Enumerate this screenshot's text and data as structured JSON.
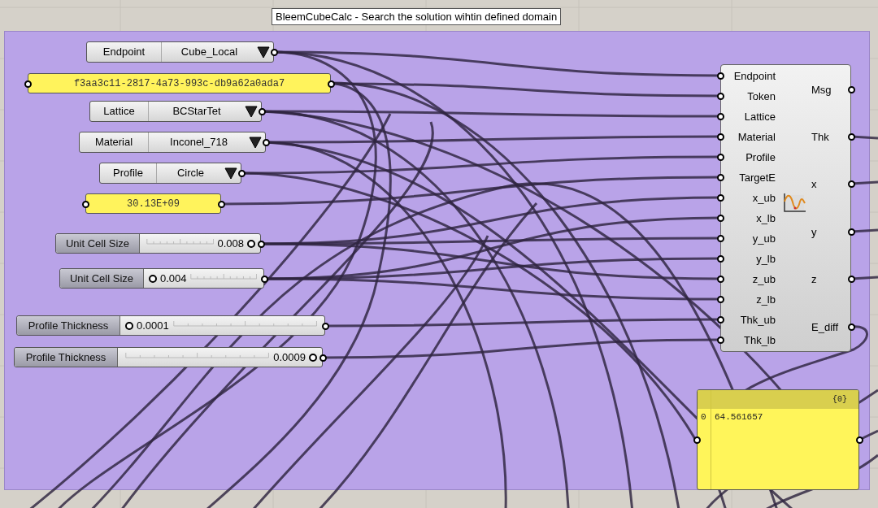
{
  "tooltip": "BleemCubeCalc - Search the solution wihtin defined domain",
  "nodes": [
    {
      "kind": "value_list",
      "label": "Endpoint",
      "value": "Cube_Local"
    },
    {
      "kind": "panel",
      "text": "f3aa3c11-2817-4a73-993c-db9a62a0ada7"
    },
    {
      "kind": "value_list",
      "label": "Lattice",
      "value": "BCStarTet"
    },
    {
      "kind": "value_list",
      "label": "Material",
      "value": "Inconel_718"
    },
    {
      "kind": "value_list",
      "label": "Profile",
      "value": "Circle"
    },
    {
      "kind": "panel",
      "text": "30.13E+09"
    },
    {
      "kind": "slider",
      "label": "Unit Cell Size",
      "value": "0.008",
      "level": 1
    },
    {
      "kind": "slider",
      "label": "Unit Cell Size",
      "value": "0.004",
      "level": 0
    },
    {
      "kind": "slider",
      "label": "Profile Thickness",
      "value": "0.0001",
      "level": 0
    },
    {
      "kind": "slider",
      "label": "Profile Thickness",
      "value": "0.0009",
      "level": 1
    }
  ],
  "component": {
    "inputs": [
      "Endpoint",
      "Token",
      "Lattice",
      "Material",
      "Profile",
      "TargetE",
      "x_ub",
      "x_lb",
      "y_ub",
      "y_lb",
      "z_ub",
      "z_lb",
      "Thk_ub",
      "Thk_lb"
    ],
    "outputs": [
      "Msg",
      "Thk",
      "x",
      "y",
      "z",
      "E_diff"
    ]
  },
  "output_panel": {
    "path": "{0}",
    "index": "0",
    "value": "64.561657"
  }
}
